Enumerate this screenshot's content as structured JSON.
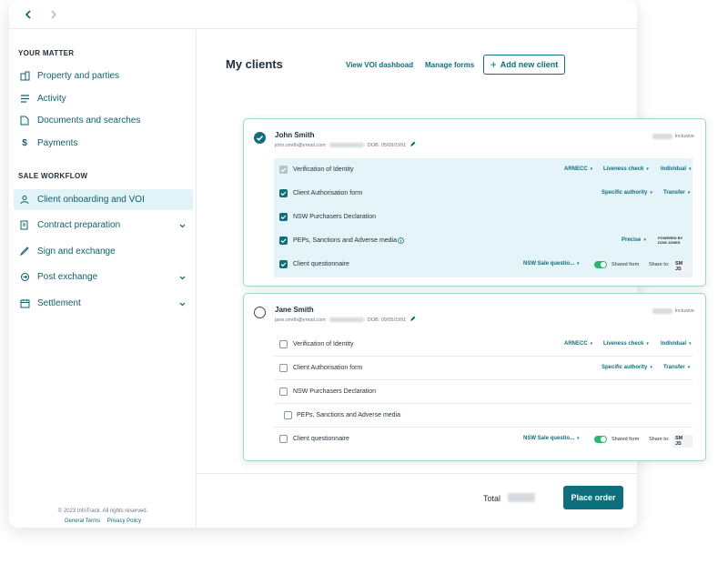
{
  "sidebar": {
    "your_matter_heading": "YOUR MATTER",
    "matter_items": [
      {
        "label": "Property and parties",
        "icon": "buildings-icon"
      },
      {
        "label": "Activity",
        "icon": "activity-list-icon"
      },
      {
        "label": "Documents and searches",
        "icon": "document-icon"
      },
      {
        "label": "Payments",
        "icon": "dollar-icon"
      }
    ],
    "workflow_heading": "SALE WORKFLOW",
    "workflow_items": [
      {
        "label": "Client onboarding and VOI",
        "icon": "person-icon",
        "active": true
      },
      {
        "label": "Contract preparation",
        "icon": "contract-icon",
        "expandable": true
      },
      {
        "label": "Sign and exchange",
        "icon": "sign-icon"
      },
      {
        "label": "Post exchange",
        "icon": "exchange-icon",
        "expandable": true
      },
      {
        "label": "Settlement",
        "icon": "calendar-icon",
        "expandable": true
      }
    ],
    "copyright": "© 2023 InfoTrack. All rights reserved.",
    "footer_links": [
      "General Terms",
      "Privacy Policy"
    ]
  },
  "main": {
    "title": "My clients",
    "view_voi_link": "View VOI dashboad",
    "manage_forms_link": "Manage forms",
    "add_client_button": "Add new client"
  },
  "clients": [
    {
      "name": "John Smith",
      "email": "john.smith@email.com",
      "dob": "DOB: 05/09/1991",
      "price_note": "Inclusive",
      "selected": true,
      "items": [
        {
          "label": "Verification of Identity",
          "state": "disabled",
          "options": [
            "ARNECC",
            "Liveness check",
            "Individual"
          ]
        },
        {
          "label": "Client Authorisation form",
          "state": "checked",
          "options": [
            "Specific authority",
            "Transfer"
          ]
        },
        {
          "label": "NSW Purchasers Declaration",
          "state": "checked",
          "options": []
        },
        {
          "label": "PEPs, Sanctions and Adverse media",
          "state": "checked",
          "options": [
            "Precise"
          ],
          "provider": [
            "POWERED BY",
            "DOW JONES"
          ]
        },
        {
          "label": "Client questionnaire",
          "state": "checked",
          "options": [
            "NSW Sale questio..."
          ],
          "shared_form": "Shared form",
          "share_to": "Share to:",
          "share_chip": "SM JS"
        }
      ]
    },
    {
      "name": "Jane Smith",
      "email": "jane.smith@email.com",
      "dob": "DOB: 09/05/1991",
      "price_note": "Inclusive",
      "selected": false,
      "items": [
        {
          "label": "Verification of Identity",
          "state": "unchecked",
          "options": [
            "ARNECC",
            "Liveness check",
            "Individual"
          ]
        },
        {
          "label": "Client Authorisation form",
          "state": "unchecked",
          "options": [
            "Specific authority",
            "Transfer"
          ]
        },
        {
          "label": "NSW Purchasers Declaration",
          "state": "unchecked",
          "options": []
        },
        {
          "label": "PEPs, Sanctions and Adverse media",
          "state": "unchecked",
          "options": []
        },
        {
          "label": "Client questionnaire",
          "state": "unchecked",
          "options": [
            "NSW Sale questio..."
          ],
          "shared_form": "Shared form",
          "share_to": "Share to:",
          "share_chip": "SM JS"
        }
      ]
    }
  ],
  "footer": {
    "total_label": "Total",
    "place_order_button": "Place order"
  },
  "colors": {
    "accent": "#0f6e7c",
    "selected_bg": "#e4f4f8",
    "toggle_on": "#2bb673"
  }
}
